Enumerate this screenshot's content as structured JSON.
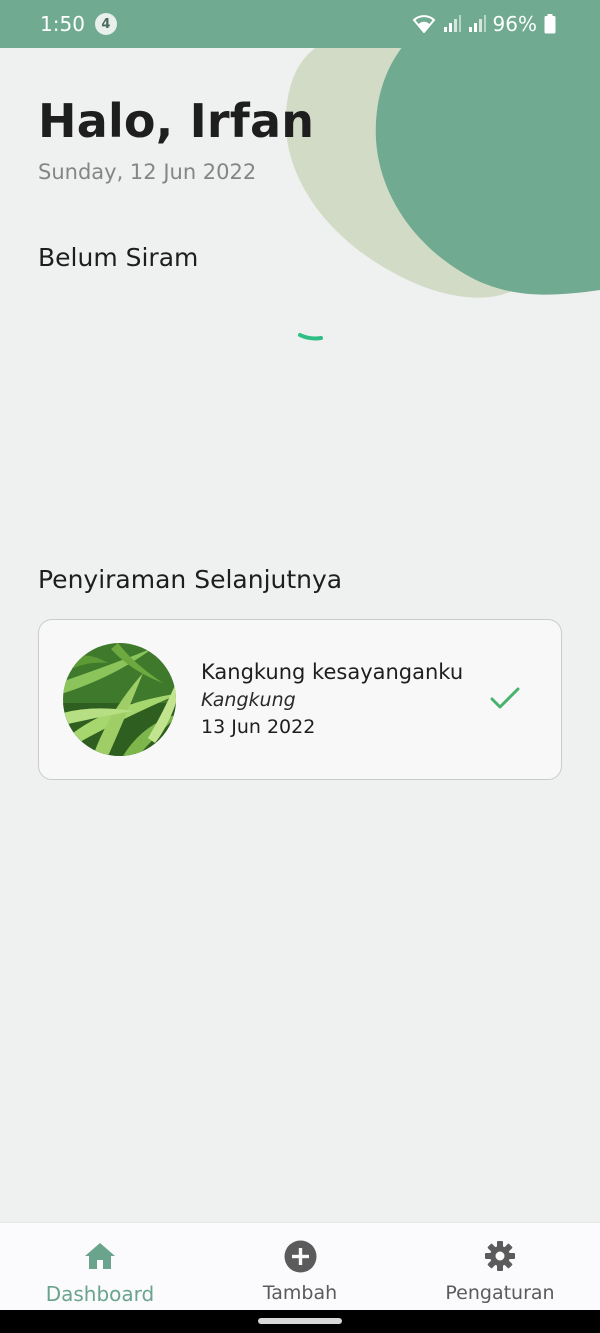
{
  "status_bar": {
    "time": "1:50",
    "notification_count": "4",
    "battery_percent": "96%"
  },
  "header": {
    "greeting": "Halo, Irfan",
    "date": "Sunday, 12 Jun 2022"
  },
  "sections": {
    "belum_siram": {
      "title": "Belum Siram"
    },
    "penyiraman_selanjutnya": {
      "title": "Penyiraman Selanjutnya",
      "plant": {
        "name": "Kangkung kesayanganku",
        "species": "Kangkung",
        "next_date": "13 Jun 2022",
        "status_icon": "check-icon"
      }
    }
  },
  "bottom_nav": {
    "items": [
      {
        "label": "Dashboard",
        "icon": "home-icon",
        "active": true
      },
      {
        "label": "Tambah",
        "icon": "add-circle-icon",
        "active": false
      },
      {
        "label": "Pengaturan",
        "icon": "gear-icon",
        "active": false
      }
    ]
  },
  "colors": {
    "primary": "#70aa91",
    "blob_light": "#d1dbc5",
    "accent_check": "#47b36e",
    "background": "#eff1f1"
  }
}
